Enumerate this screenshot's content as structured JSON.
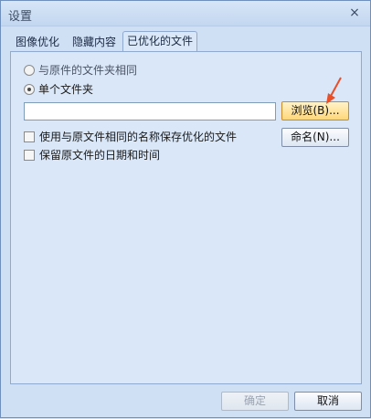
{
  "window": {
    "title": "设置",
    "close_glyph": "×"
  },
  "tabs": [
    {
      "label": "图像优化",
      "active": false
    },
    {
      "label": "隐藏内容",
      "active": false
    },
    {
      "label": "已优化的文件",
      "active": true
    }
  ],
  "options": {
    "same_folder_label": "与原件的文件夹相同",
    "single_folder_label": "单个文件夹",
    "selected": "single_folder",
    "path_value": "",
    "browse_label": "浏览(B)...",
    "same_name_label": "使用与原文件相同的名称保存优化的文件",
    "same_name_checked": false,
    "rename_label": "命名(N)...",
    "keep_date_label": "保留原文件的日期和时间",
    "keep_date_checked": false
  },
  "footer": {
    "ok_label": "确定",
    "cancel_label": "取消"
  },
  "colors": {
    "accent_arrow": "#e8502a"
  }
}
